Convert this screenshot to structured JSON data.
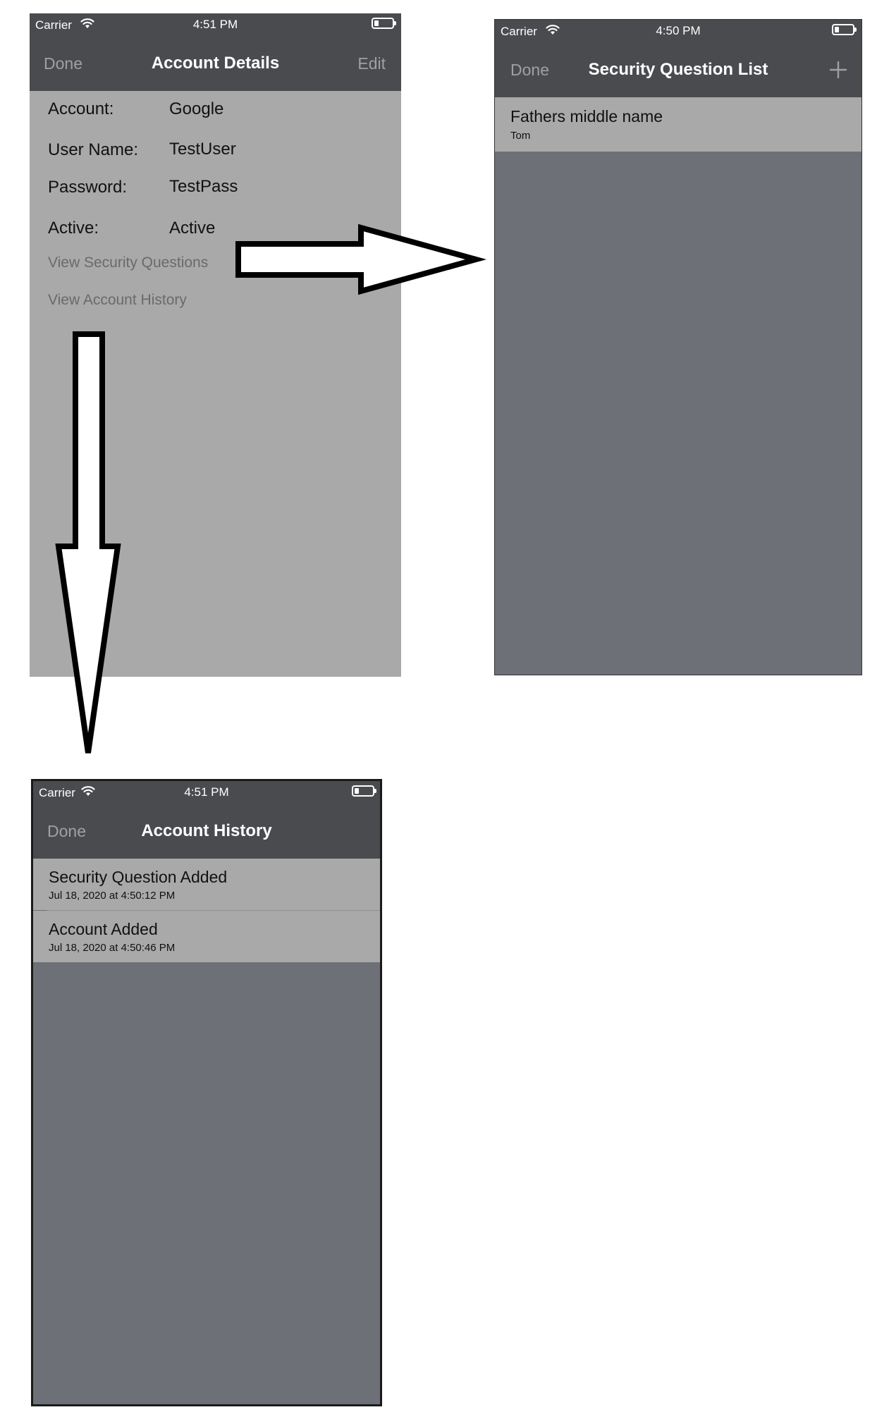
{
  "details_screen": {
    "status": {
      "carrier": "Carrier",
      "time": "4:51 PM"
    },
    "nav": {
      "left": "Done",
      "title": "Account Details",
      "right": "Edit"
    },
    "fields": [
      {
        "label": "Account:",
        "value": "Google"
      },
      {
        "label": "User Name:",
        "value": "TestUser"
      },
      {
        "label": "Password:",
        "value": "TestPass"
      },
      {
        "label": "Active:",
        "value": "Active"
      }
    ],
    "links": {
      "security": "View Security Questions",
      "history": "View Account History"
    }
  },
  "security_screen": {
    "status": {
      "carrier": "Carrier",
      "time": "4:50 PM"
    },
    "nav": {
      "left": "Done",
      "title": "Security Question List",
      "add_icon": "plus-icon"
    },
    "rows": [
      {
        "title": "Fathers middle name",
        "subtitle": "Tom"
      }
    ]
  },
  "history_screen": {
    "status": {
      "carrier": "Carrier",
      "time": "4:51 PM"
    },
    "nav": {
      "left": "Done",
      "title": "Account History"
    },
    "rows": [
      {
        "title": "Security Question Added",
        "subtitle": "Jul 18, 2020 at 4:50:12 PM"
      },
      {
        "title": "Account Added",
        "subtitle": "Jul 18, 2020 at 4:50:46 PM"
      }
    ]
  },
  "colors": {
    "nav_bar": "#4a4b4f",
    "content_light": "#a9a9a9",
    "content_dark": "#6d7076",
    "nav_button": "#a0a0a0"
  }
}
